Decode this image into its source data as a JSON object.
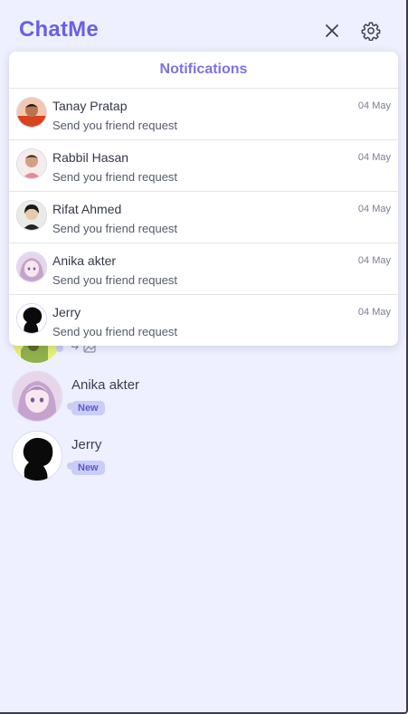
{
  "app": {
    "brand": "ChatMe",
    "brand_color": "#6b5fe3",
    "close_icon": "close-icon",
    "settings_icon": "gear-icon"
  },
  "notifications": {
    "title": "Notifications",
    "items": [
      {
        "name": "Tanay Pratap",
        "message": "Send you friend request",
        "date": "04 May",
        "avatar": "avatar-tanay"
      },
      {
        "name": "Rabbil Hasan",
        "message": "Send you friend request",
        "date": "04 May",
        "avatar": "avatar-rabbil"
      },
      {
        "name": "Rifat Ahmed",
        "message": "Send you friend request",
        "date": "04 May",
        "avatar": "avatar-rifat"
      },
      {
        "name": "Anika akter",
        "message": "Send you friend request",
        "date": "04 May",
        "avatar": "avatar-anika"
      },
      {
        "name": "Jerry",
        "message": "Send you friend request",
        "date": "04 May",
        "avatar": "avatar-jerry"
      }
    ]
  },
  "chats": [
    {
      "name": "Anika akter",
      "badge": "New",
      "avatar": "avatar-anika"
    },
    {
      "name": "Jerry",
      "badge": "New",
      "avatar": "avatar-jerry"
    }
  ]
}
